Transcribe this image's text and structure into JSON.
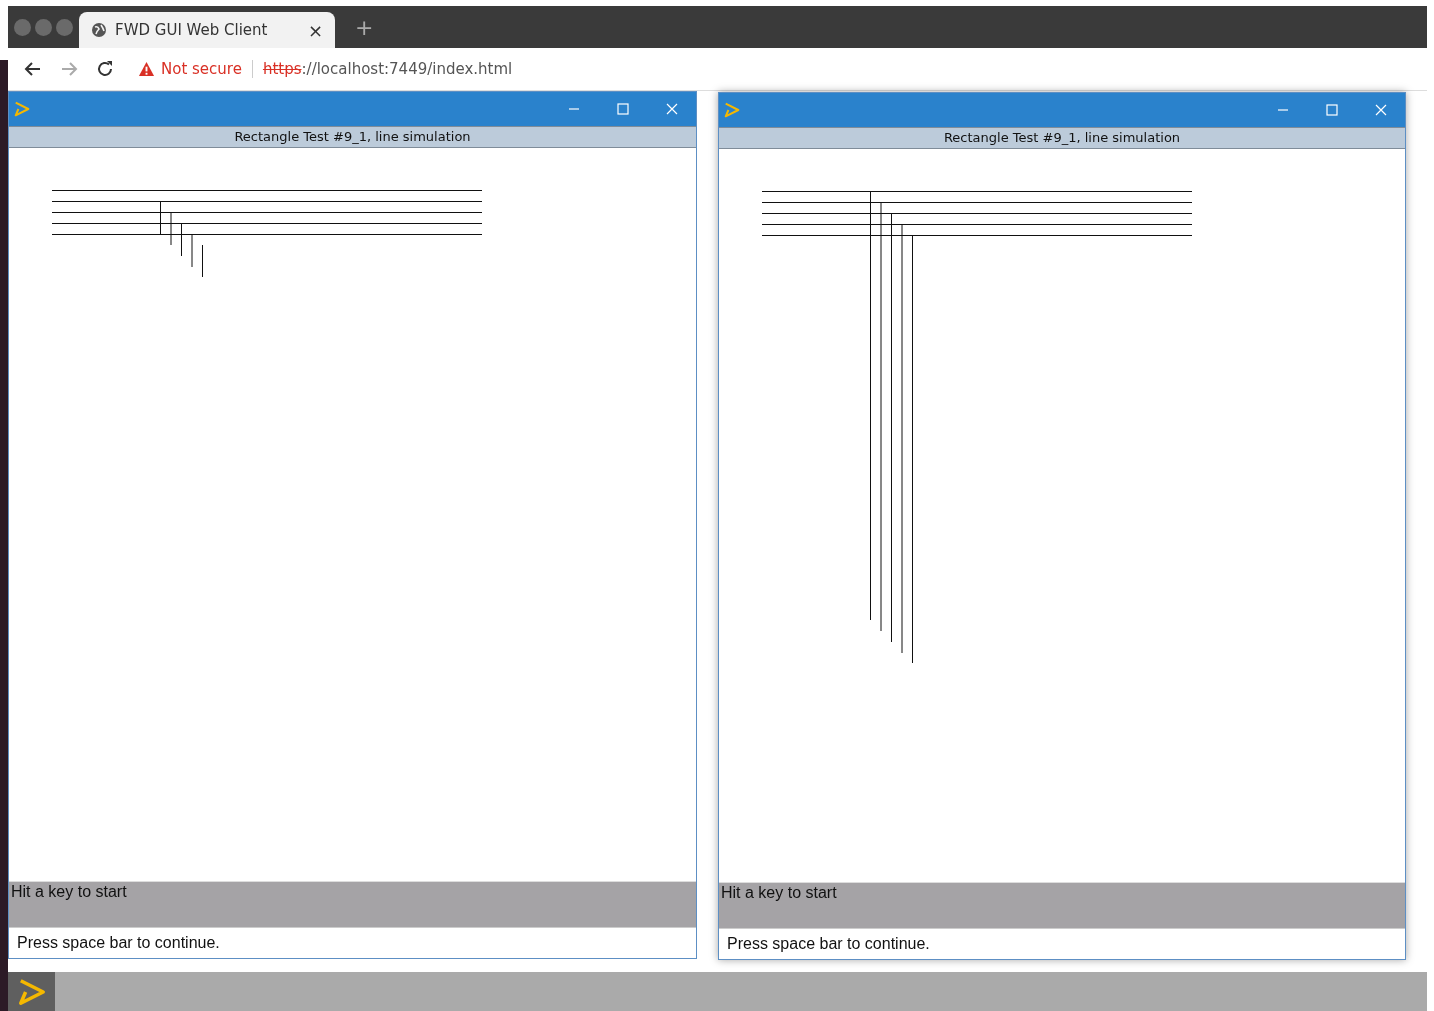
{
  "browser": {
    "tab": {
      "title": "FWD GUI Web Client",
      "close": "×"
    },
    "new_tab": "+",
    "security": "Not secure",
    "url_scheme": "https",
    "url_rest": "://localhost:7449/index.html"
  },
  "windows": [
    {
      "title": "Rectangle Test #9_1, line simulation",
      "status": "Hit a key to start",
      "message": "Press space bar to continue."
    },
    {
      "title": "Rectangle Test #9_1, line simulation",
      "status": "Hit a key to start",
      "message": "Press space bar to continue."
    }
  ]
}
